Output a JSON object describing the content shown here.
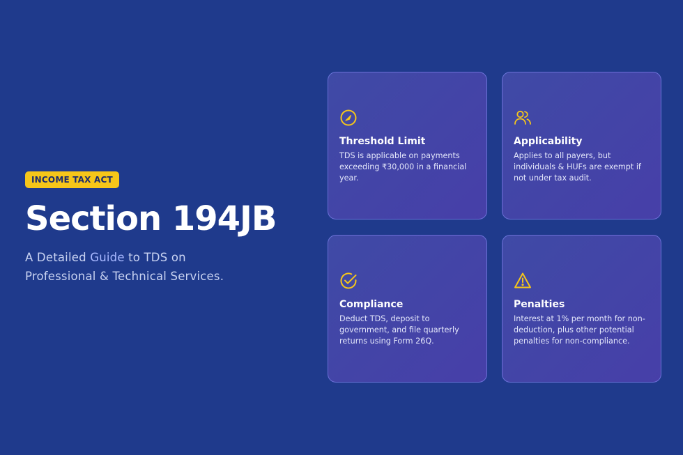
{
  "badge": "INCOME TAX ACT",
  "title": "Section 194JB",
  "subtitle": {
    "line1_a": "A Detailed ",
    "line1_b": "Guide",
    "line1_c": " to TDS on",
    "line2": "Professional & Technical Services."
  },
  "accent_color": "#f6c619",
  "background_color": "#1f3a8c",
  "cards": [
    {
      "icon": "gauge-icon",
      "title": "Threshold Limit",
      "text": "TDS is applicable on payments exceeding ₹30,000 in a financial year."
    },
    {
      "icon": "users-icon",
      "title": "Applicability",
      "text": "Applies to all payers, but individuals & HUFs are exempt if not under tax audit."
    },
    {
      "icon": "check-circle-icon",
      "title": "Compliance",
      "text": "Deduct TDS, deposit to government, and file quarterly returns using Form 26Q."
    },
    {
      "icon": "warning-icon",
      "title": "Penalties",
      "text": "Interest at 1% per month for non-deduction, plus other potential penalties for non-compliance."
    }
  ]
}
